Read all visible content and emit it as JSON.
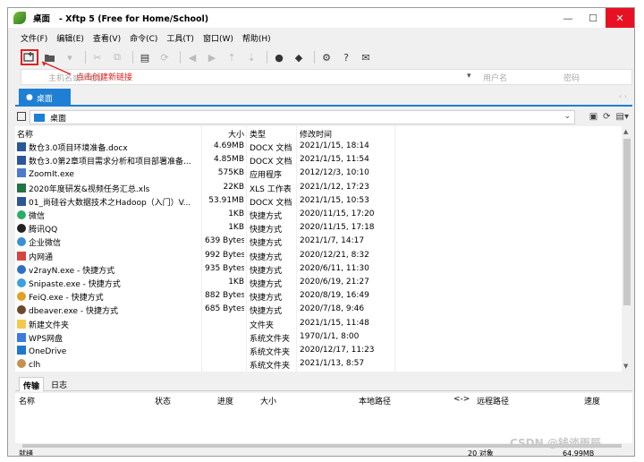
{
  "window": {
    "title": "桌面   - Xftp 5 (Free for Home/School)",
    "controls": [
      "—",
      "☐",
      "✕"
    ]
  },
  "menu": [
    "文件(F)",
    "编辑(E)",
    "查看(V)",
    "命令(C)",
    "工具(T)",
    "窗口(W)",
    "帮助(H)"
  ],
  "toolbar": {
    "new_session_icon": "new-session-icon",
    "annotation": "点击创建新链接"
  },
  "address": {
    "host_placeholder": "主机名或IP地址",
    "user_placeholder": "用户名",
    "password_placeholder": "密码"
  },
  "tab": {
    "label": "桌面"
  },
  "path": {
    "current": "桌面"
  },
  "columns": {
    "name": "名称",
    "size": "大小",
    "type": "类型",
    "modified": "修改时间"
  },
  "files": [
    {
      "name": "数仓3.0项目环境准备.docx",
      "size": "4.69MB",
      "type": "DOCX 文档",
      "modified": "2021/1/15, 18:14",
      "icon": "word",
      "color": "#2b579a"
    },
    {
      "name": "数仓3.0第2章项目需求分析和项目部署准备...",
      "size": "4.85MB",
      "type": "DOCX 文档",
      "modified": "2021/1/15, 11:54",
      "icon": "word",
      "color": "#2b579a"
    },
    {
      "name": "ZoomIt.exe",
      "size": "575KB",
      "type": "应用程序",
      "modified": "2012/12/3, 10:10",
      "icon": "app",
      "color": "#4a7bd0"
    },
    {
      "name": "2020年度研发&视频任务汇总.xls",
      "size": "22KB",
      "type": "XLS 工作表",
      "modified": "2021/1/12, 17:23",
      "icon": "excel",
      "color": "#217346"
    },
    {
      "name": "01_尚硅谷大数据技术之Hadoop（入门）V...",
      "size": "53.91MB",
      "type": "DOCX 文档",
      "modified": "2021/1/15, 10:53",
      "icon": "word",
      "color": "#2b579a"
    },
    {
      "name": "微信",
      "size": "1KB",
      "type": "快捷方式",
      "modified": "2020/11/15, 17:20",
      "icon": "wechat",
      "color": "#2aae67"
    },
    {
      "name": "腾讯QQ",
      "size": "1KB",
      "type": "快捷方式",
      "modified": "2020/11/15, 17:18",
      "icon": "qq",
      "color": "#222222"
    },
    {
      "name": "企业微信",
      "size": "639 Bytes",
      "type": "快捷方式",
      "modified": "2021/1/7, 14:17",
      "icon": "wework",
      "color": "#3b8fd6"
    },
    {
      "name": "内网通",
      "size": "992 Bytes",
      "type": "快捷方式",
      "modified": "2020/12/21, 8:32",
      "icon": "intranet",
      "color": "#d64541"
    },
    {
      "name": "v2rayN.exe - 快捷方式",
      "size": "935 Bytes",
      "type": "快捷方式",
      "modified": "2020/6/11, 11:30",
      "icon": "v2ray",
      "color": "#2f6fc8"
    },
    {
      "name": "Snipaste.exe - 快捷方式",
      "size": "1KB",
      "type": "快捷方式",
      "modified": "2020/6/19, 21:27",
      "icon": "snipaste",
      "color": "#3aa0e0"
    },
    {
      "name": "FeiQ.exe - 快捷方式",
      "size": "882 Bytes",
      "type": "快捷方式",
      "modified": "2020/8/19, 16:49",
      "icon": "feiq",
      "color": "#e0a020"
    },
    {
      "name": "dbeaver.exe - 快捷方式",
      "size": "685 Bytes",
      "type": "快捷方式",
      "modified": "2020/7/18, 9:46",
      "icon": "dbeaver",
      "color": "#6b4a2b"
    },
    {
      "name": "新建文件夹",
      "size": "",
      "type": "文件夹",
      "modified": "2021/1/15, 11:48",
      "icon": "folder",
      "color": "#f2c94c"
    },
    {
      "name": "WPS网盘",
      "size": "",
      "type": "系统文件夹",
      "modified": "1970/1/1, 8:00",
      "icon": "wps",
      "color": "#3c7ce0"
    },
    {
      "name": "OneDrive",
      "size": "",
      "type": "系统文件夹",
      "modified": "2020/12/17, 11:23",
      "icon": "onedrive",
      "color": "#1e78d0"
    },
    {
      "name": "clh",
      "size": "",
      "type": "系统文件夹",
      "modified": "2021/1/13, 8:57",
      "icon": "user",
      "color": "#c89050"
    }
  ],
  "lower_tabs": [
    "传输",
    "日志"
  ],
  "transfer_columns": [
    "名称",
    "状态",
    "进度",
    "大小",
    "本地路径",
    "<->",
    "远程路径",
    "速度"
  ],
  "status": {
    "left": "就绪",
    "count": "20 对象",
    "size": "64.99MB"
  },
  "watermark": "CSDN @钱谈雨辰"
}
